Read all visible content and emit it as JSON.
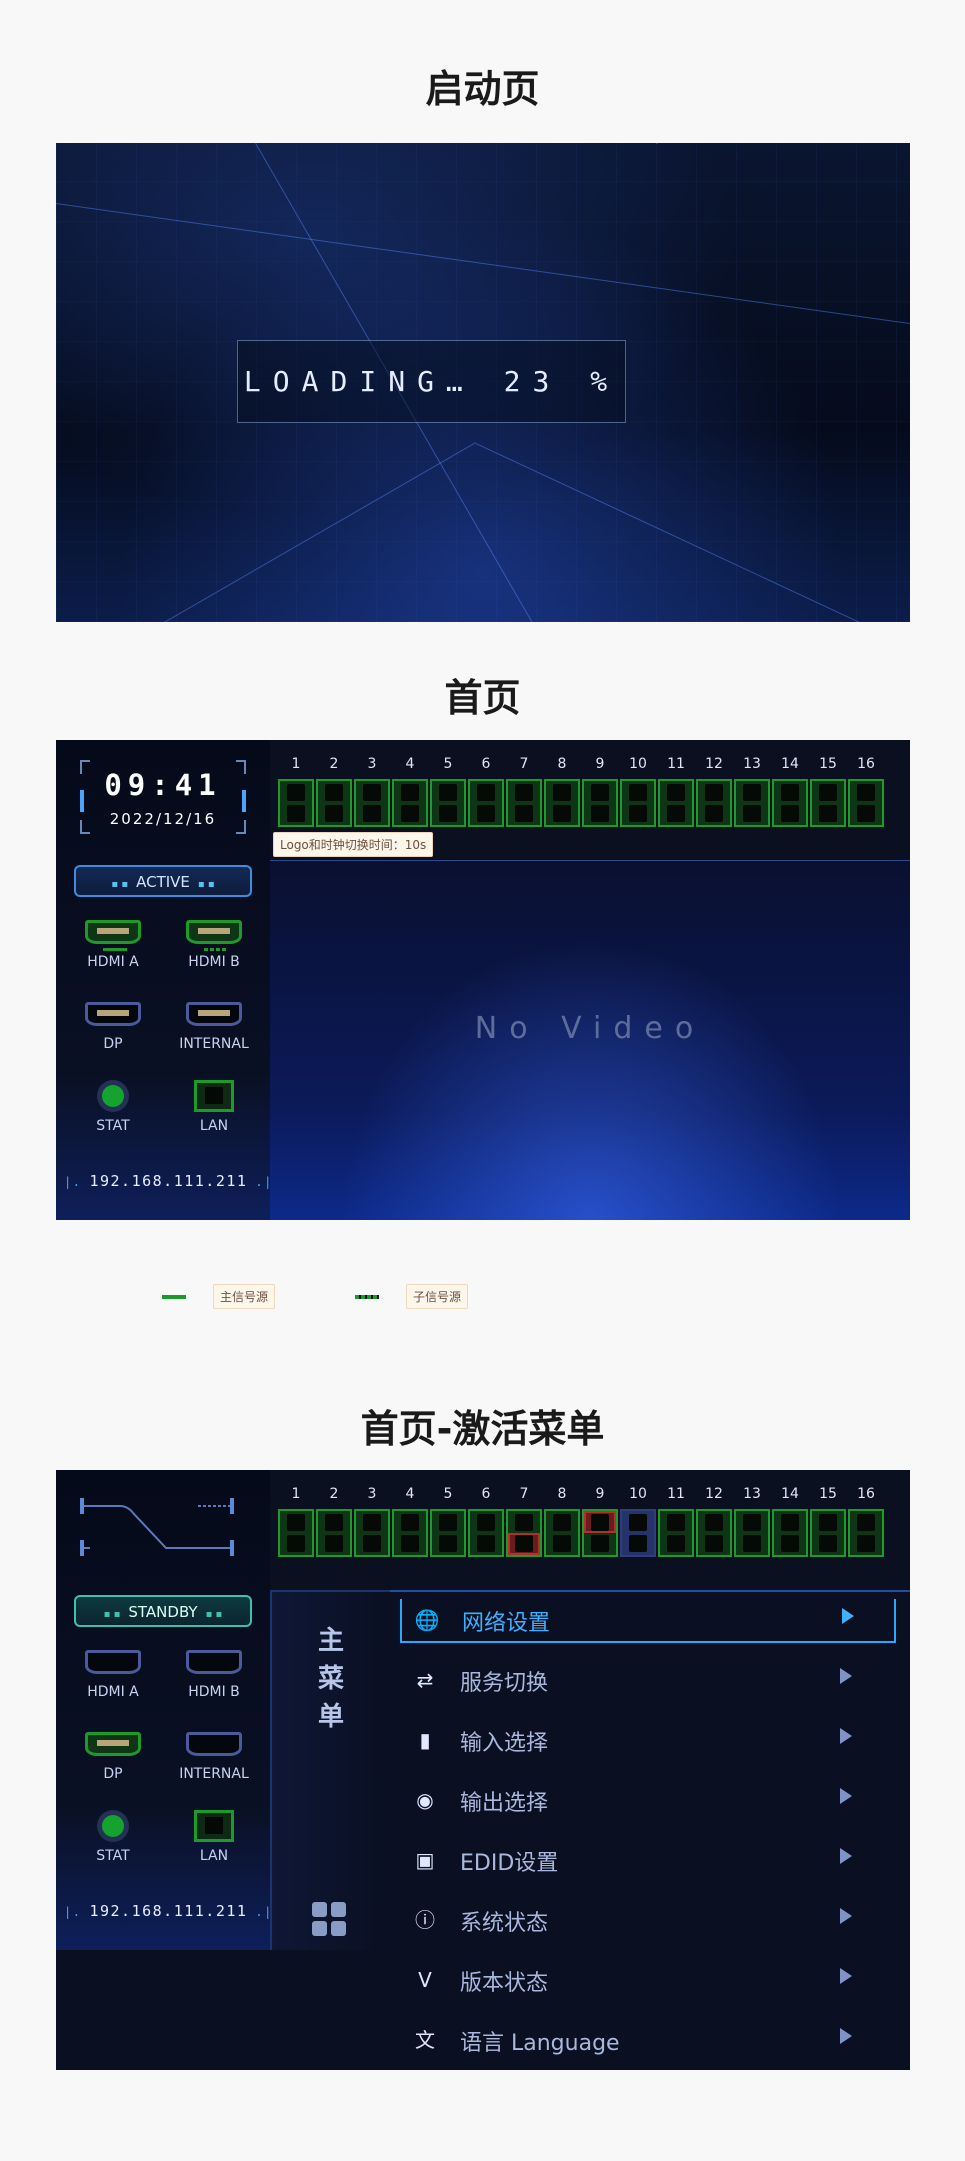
{
  "sections": {
    "startup": "启动页",
    "home": "首页",
    "home_menu": "首页-激活菜单"
  },
  "loading": {
    "text": "LOADING… 23 %",
    "progress_percent": 23
  },
  "home": {
    "time": "09:41",
    "date": "2022/12/16",
    "status": "ACTIVE",
    "tooltip": "Logo和时钟切换时间：10s",
    "io": [
      {
        "label": "HDMI A",
        "state": "main"
      },
      {
        "label": "HDMI B",
        "state": "sub"
      },
      {
        "label": "DP",
        "state": "idle"
      },
      {
        "label": "INTERNAL",
        "state": "idle"
      },
      {
        "label": "STAT",
        "state": "on"
      },
      {
        "label": "LAN",
        "state": "on"
      }
    ],
    "ip": "192.168.111.211",
    "video_text": "No Video",
    "ports": {
      "numbers": [
        "1",
        "2",
        "3",
        "4",
        "5",
        "6",
        "7",
        "8",
        "9",
        "10",
        "11",
        "12",
        "13",
        "14",
        "15",
        "16"
      ],
      "states": [
        "green",
        "green",
        "green",
        "green",
        "green",
        "green",
        "green",
        "green",
        "green",
        "green",
        "green",
        "green",
        "green",
        "green",
        "green",
        "green"
      ]
    }
  },
  "legend": {
    "main": "主信号源",
    "sub": "子信号源",
    "color": "#1a9a2a"
  },
  "menu_screen": {
    "status": "STANDBY",
    "io": [
      {
        "label": "HDMI A",
        "state": "idle"
      },
      {
        "label": "HDMI B",
        "state": "idle"
      },
      {
        "label": "DP",
        "state": "active"
      },
      {
        "label": "INTERNAL",
        "state": "idle"
      },
      {
        "label": "STAT",
        "state": "on"
      },
      {
        "label": "LAN",
        "state": "on"
      }
    ],
    "ip": "192.168.111.211",
    "ports": {
      "numbers": [
        "1",
        "2",
        "3",
        "4",
        "5",
        "6",
        "7",
        "8",
        "9",
        "10",
        "11",
        "12",
        "13",
        "14",
        "15",
        "16"
      ],
      "states": [
        "green",
        "green",
        "green",
        "green",
        "green",
        "green",
        "red-bottom",
        "green",
        "red-top",
        "blue",
        "green",
        "green",
        "green",
        "green",
        "green",
        "green"
      ]
    },
    "menu_title": "主菜单",
    "items": [
      {
        "label": "网络设置",
        "icon": "globe-icon",
        "selected": true
      },
      {
        "label": "服务切换",
        "icon": "switch-icon"
      },
      {
        "label": "输入选择",
        "icon": "input-plug-icon"
      },
      {
        "label": "输出选择",
        "icon": "broadcast-icon"
      },
      {
        "label": "EDID设置",
        "icon": "frame-icon"
      },
      {
        "label": "系统状态",
        "icon": "info-icon"
      },
      {
        "label": "版本状态",
        "icon": "version-bookmark-icon"
      },
      {
        "label": "语言 Language",
        "icon": "language-icon"
      }
    ]
  },
  "colors": {
    "port_green": "#1f9a2a",
    "port_red": "#a03030",
    "port_blue": "#25336a",
    "accent": "#2aa8ff"
  }
}
